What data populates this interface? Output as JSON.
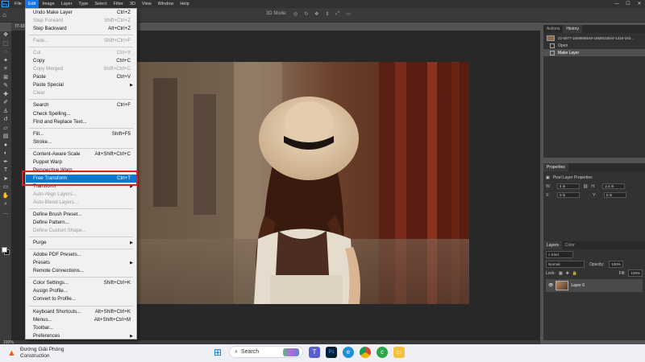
{
  "menubar": {
    "logo": "Ps",
    "items": [
      "File",
      "Edit",
      "Image",
      "Layer",
      "Type",
      "Select",
      "Filter",
      "3D",
      "View",
      "Window",
      "Help"
    ],
    "active_index": 1
  },
  "options_bar": {
    "mode_label": "3D Mode:"
  },
  "document_tab": {
    "title": "77-163..."
  },
  "edit_menu": {
    "items": [
      {
        "label": "Undo Make Layer",
        "shortcut": "Ctrl+Z",
        "enabled": true
      },
      {
        "label": "Step Forward",
        "shortcut": "Shift+Ctrl+Z",
        "enabled": false
      },
      {
        "label": "Step Backward",
        "shortcut": "Alt+Ctrl+Z",
        "enabled": true
      },
      {
        "sep": true
      },
      {
        "label": "Fade...",
        "shortcut": "Shift+Ctrl+F",
        "enabled": false
      },
      {
        "sep": true
      },
      {
        "label": "Cut",
        "shortcut": "Ctrl+X",
        "enabled": false
      },
      {
        "label": "Copy",
        "shortcut": "Ctrl+C",
        "enabled": true
      },
      {
        "label": "Copy Merged",
        "shortcut": "Shift+Ctrl+C",
        "enabled": false
      },
      {
        "label": "Paste",
        "shortcut": "Ctrl+V",
        "enabled": true
      },
      {
        "label": "Paste Special",
        "shortcut": "",
        "submenu": true,
        "enabled": true
      },
      {
        "label": "Clear",
        "shortcut": "",
        "enabled": false
      },
      {
        "sep": true
      },
      {
        "label": "Search",
        "shortcut": "Ctrl+F",
        "enabled": true
      },
      {
        "label": "Check Spelling...",
        "shortcut": "",
        "enabled": true
      },
      {
        "label": "Find and Replace Text...",
        "shortcut": "",
        "enabled": true
      },
      {
        "sep": true
      },
      {
        "label": "Fill...",
        "shortcut": "Shift+F5",
        "enabled": true
      },
      {
        "label": "Stroke...",
        "shortcut": "",
        "enabled": true
      },
      {
        "sep": true
      },
      {
        "label": "Content-Aware Scale",
        "shortcut": "Alt+Shift+Ctrl+C",
        "enabled": true
      },
      {
        "label": "Puppet Warp",
        "shortcut": "",
        "enabled": true
      },
      {
        "label": "Perspective Warp",
        "shortcut": "",
        "enabled": true
      },
      {
        "label": "Free Transform",
        "shortcut": "Ctrl+T",
        "enabled": true,
        "highlighted": true
      },
      {
        "label": "Transform",
        "shortcut": "",
        "submenu": true,
        "enabled": true
      },
      {
        "label": "Auto-Align Layers...",
        "shortcut": "",
        "enabled": false
      },
      {
        "label": "Auto-Blend Layers...",
        "shortcut": "",
        "enabled": false
      },
      {
        "sep": true
      },
      {
        "label": "Define Brush Preset...",
        "shortcut": "",
        "enabled": true
      },
      {
        "label": "Define Pattern...",
        "shortcut": "",
        "enabled": true
      },
      {
        "label": "Define Custom Shape...",
        "shortcut": "",
        "enabled": false
      },
      {
        "sep": true
      },
      {
        "label": "Purge",
        "shortcut": "",
        "submenu": true,
        "enabled": true
      },
      {
        "sep": true
      },
      {
        "label": "Adobe PDF Presets...",
        "shortcut": "",
        "enabled": true
      },
      {
        "label": "Presets",
        "shortcut": "",
        "submenu": true,
        "enabled": true
      },
      {
        "label": "Remote Connections...",
        "shortcut": "",
        "enabled": true
      },
      {
        "sep": true
      },
      {
        "label": "Color Settings...",
        "shortcut": "Shift+Ctrl+K",
        "enabled": true
      },
      {
        "label": "Assign Profile...",
        "shortcut": "",
        "enabled": true
      },
      {
        "label": "Convert to Profile...",
        "shortcut": "",
        "enabled": true
      },
      {
        "sep": true
      },
      {
        "label": "Keyboard Shortcuts...",
        "shortcut": "Alt+Shift+Ctrl+K",
        "enabled": true
      },
      {
        "label": "Menus...",
        "shortcut": "Alt+Shift+Ctrl+M",
        "enabled": true
      },
      {
        "label": "Toolbar...",
        "shortcut": "",
        "enabled": true
      },
      {
        "label": "Preferences",
        "shortcut": "",
        "submenu": true,
        "enabled": true
      }
    ]
  },
  "history_panel": {
    "tabs": [
      "Actions",
      "History"
    ],
    "active_tab": "History",
    "snapshot": "22-5977-1658858549-1658532844-1316-163...",
    "states": [
      "Open",
      "Make Layer"
    ],
    "selected_state": "Make Layer"
  },
  "properties_panel": {
    "tab": "Properties",
    "title": "Pixel Layer Properties",
    "w_label": "W:",
    "w_value": "4 in",
    "h_label": "H:",
    "h_value": "2.4 in",
    "x_label": "X:",
    "x_value": "0 in",
    "y_label": "Y:",
    "y_value": "0 in"
  },
  "layers_panel": {
    "tabs": [
      "Layers",
      "Color"
    ],
    "active_tab": "Layers",
    "kind": "Kind",
    "blend": "Normal",
    "opacity_label": "Opacity:",
    "opacity": "100%",
    "lock_label": "Lock:",
    "fill_label": "Fill:",
    "fill": "100%",
    "layer_name": "Layer 0"
  },
  "statusbar": {
    "zoom": "100%"
  },
  "taskbar": {
    "weather_line1": "Đường Giải Phóng",
    "weather_line2": "Construction",
    "search_placeholder": "Search"
  }
}
